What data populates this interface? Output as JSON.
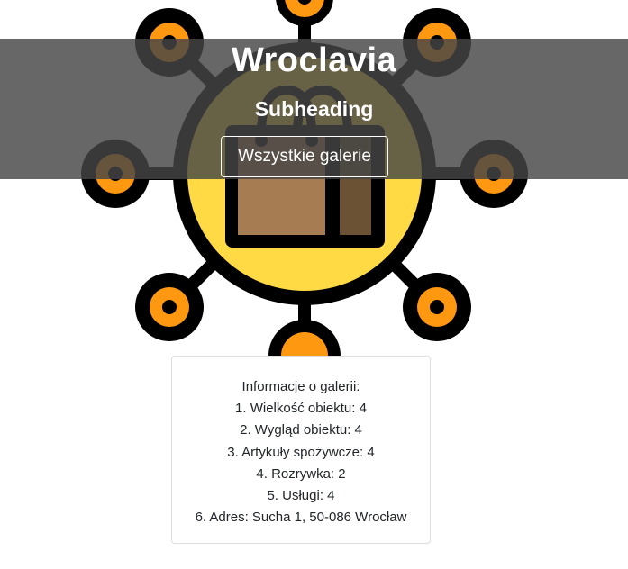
{
  "hero": {
    "title": "Wroclavia",
    "subtitle": "Subheading",
    "button_label": "Wszystkie galerie"
  },
  "info": {
    "heading": "Informacje o galerii:",
    "items": [
      "1. Wielkość obiektu: 4",
      "2. Wygląd obiektu: 4",
      "3. Artykuły spożywcze: 4",
      "4. Rozrywka: 2",
      "5. Usługi: 4",
      "6. Adres: Sucha 1, 50-086 Wrocław"
    ]
  },
  "colors": {
    "overlay": "#464646",
    "hub": "#ffda44",
    "node": "#ff9811",
    "outline": "#000000",
    "bag": "#a67c52"
  },
  "icons": [
    "network-hub-icon",
    "shopping-bag-icon"
  ]
}
